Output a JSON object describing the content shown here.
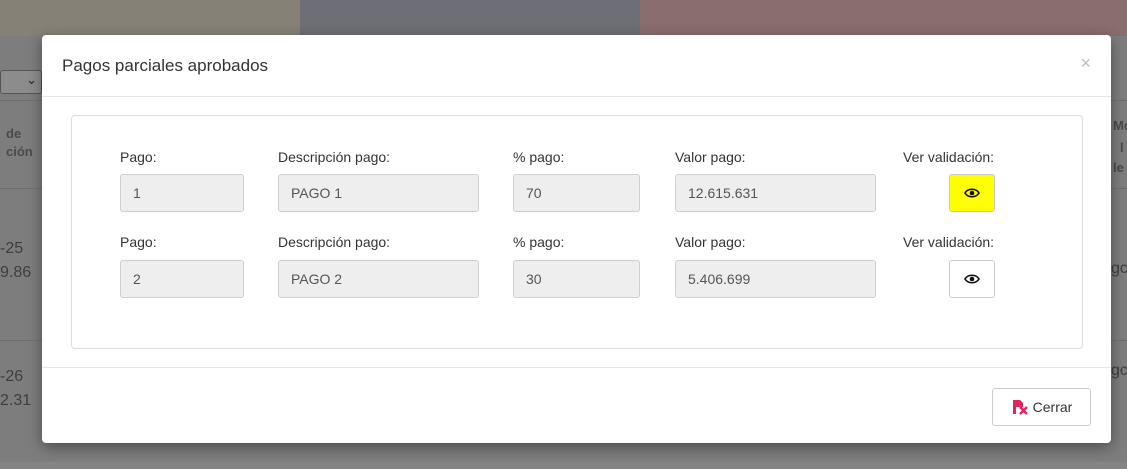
{
  "background": {
    "col_header_line1": "de",
    "col_header_line2": "ción",
    "row1_line1": "-25",
    "row1_line2": "9.86",
    "row2_line1": "-26",
    "row2_line2": "2.31",
    "right_header_1": "Mo",
    "right_header_2": "l",
    "right_header_3": "le",
    "right_row1": "gc",
    "right_row2": "gc"
  },
  "modal": {
    "title": "Pagos parciales aprobados",
    "close_glyph": "×",
    "labels": {
      "pago": "Pago:",
      "descripcion": "Descripción pago:",
      "porcentaje": "% pago:",
      "valor": "Valor pago:",
      "validacion": "Ver validación:"
    },
    "rows": [
      {
        "pago": "1",
        "descripcion": "PAGO 1",
        "porcentaje": "70",
        "valor": "12.615.631",
        "highlighted": true
      },
      {
        "pago": "2",
        "descripcion": "PAGO 2",
        "porcentaje": "30",
        "valor": "5.406.699",
        "highlighted": false
      }
    ],
    "footer": {
      "close_label": "Cerrar"
    }
  },
  "colors": {
    "highlight": "#ffff00",
    "close_icon": "#e0245e"
  },
  "icons": {
    "view": "eye-icon",
    "close": "close-icon",
    "cerrar": "file-x-icon"
  }
}
